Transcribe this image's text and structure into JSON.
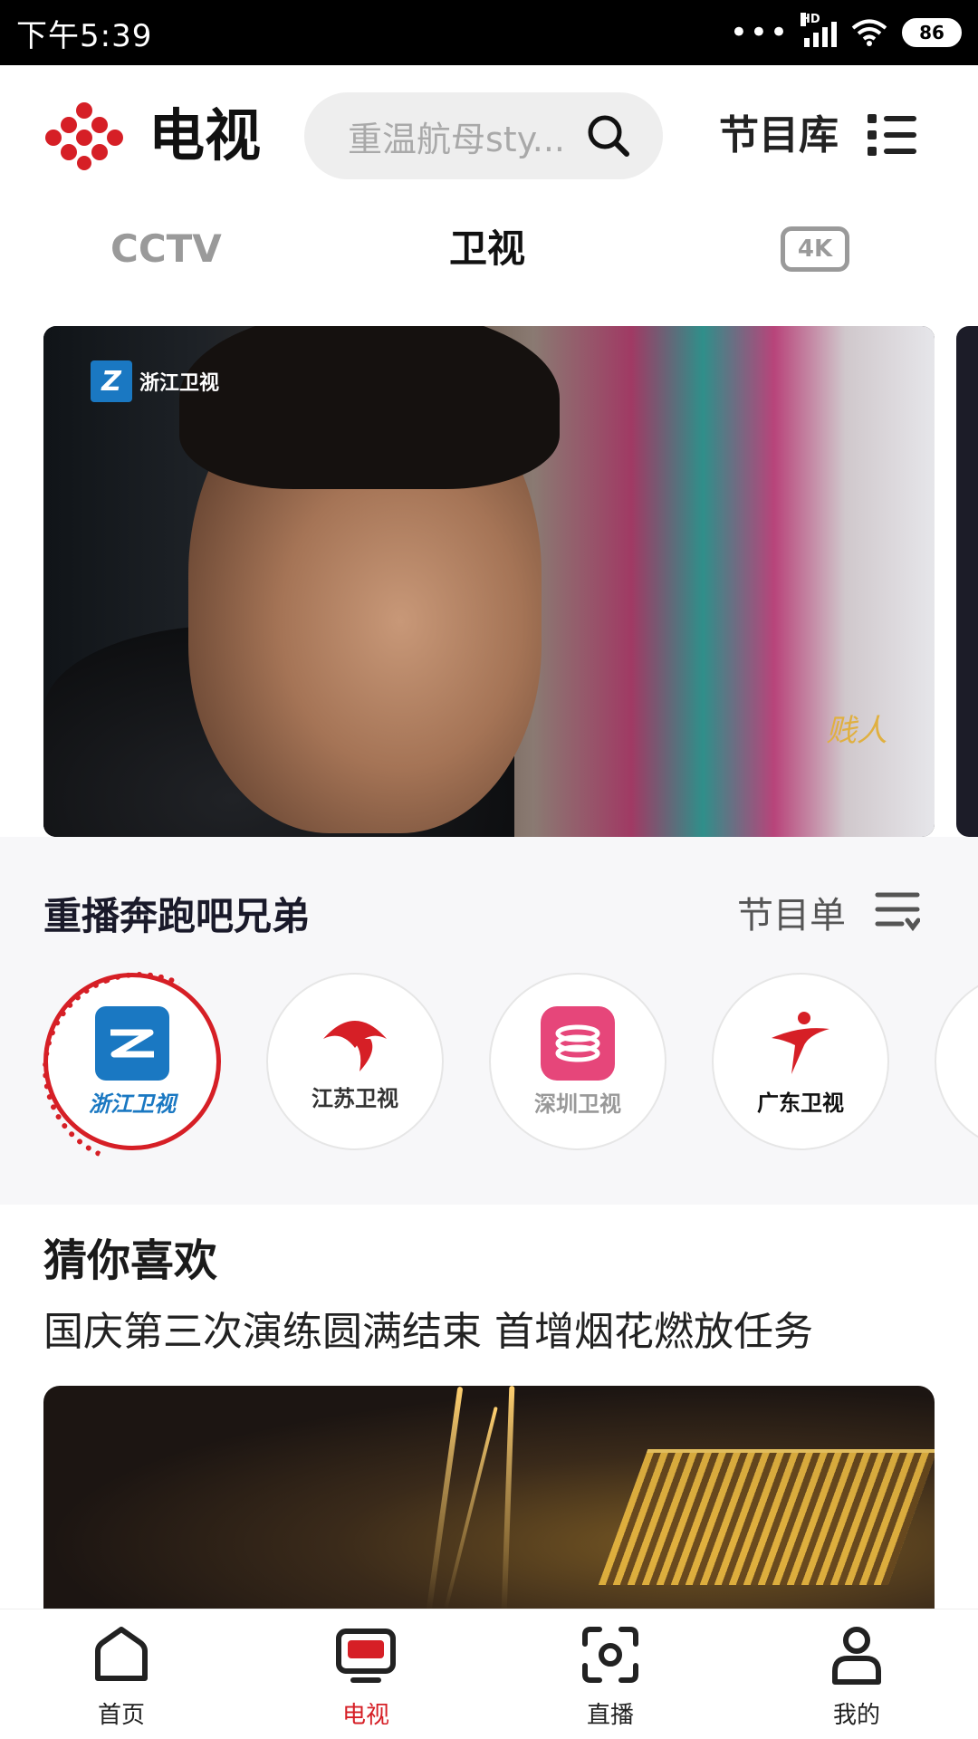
{
  "status_bar": {
    "time": "下午5:39",
    "network": "HD",
    "battery": "86"
  },
  "header": {
    "title": "电视",
    "search_placeholder": "重温航母sty...",
    "library_label": "节目库"
  },
  "tabs": [
    {
      "label": "CCTV",
      "active": false
    },
    {
      "label": "卫视",
      "active": true
    },
    {
      "label": "4K",
      "active": false
    }
  ],
  "hero": {
    "channel_logo": "浙江卫视",
    "watermark": "贱人"
  },
  "replay": {
    "title": "重播奔跑吧兄弟",
    "schedule_label": "节目单",
    "channels": [
      {
        "name": "浙江卫视",
        "color": "#1a78c2",
        "active": true
      },
      {
        "name": "江苏卫视",
        "color": "#d61f26",
        "active": false
      },
      {
        "name": "深圳卫视",
        "color": "#e6467a",
        "active": false
      },
      {
        "name": "广东卫视",
        "color": "#d61f26",
        "active": false
      }
    ]
  },
  "recommend": {
    "title": "猜你喜欢",
    "headline": "国庆第三次演练圆满结束 首增烟花燃放任务"
  },
  "bottom_nav": [
    {
      "label": "首页",
      "icon": "home-icon",
      "active": false
    },
    {
      "label": "电视",
      "icon": "tv-icon",
      "active": true
    },
    {
      "label": "直播",
      "icon": "live-icon",
      "active": false
    },
    {
      "label": "我的",
      "icon": "profile-icon",
      "active": false
    }
  ],
  "colors": {
    "accent": "#d61f26",
    "text": "#1a1a1a",
    "muted": "#9a9a9a"
  }
}
